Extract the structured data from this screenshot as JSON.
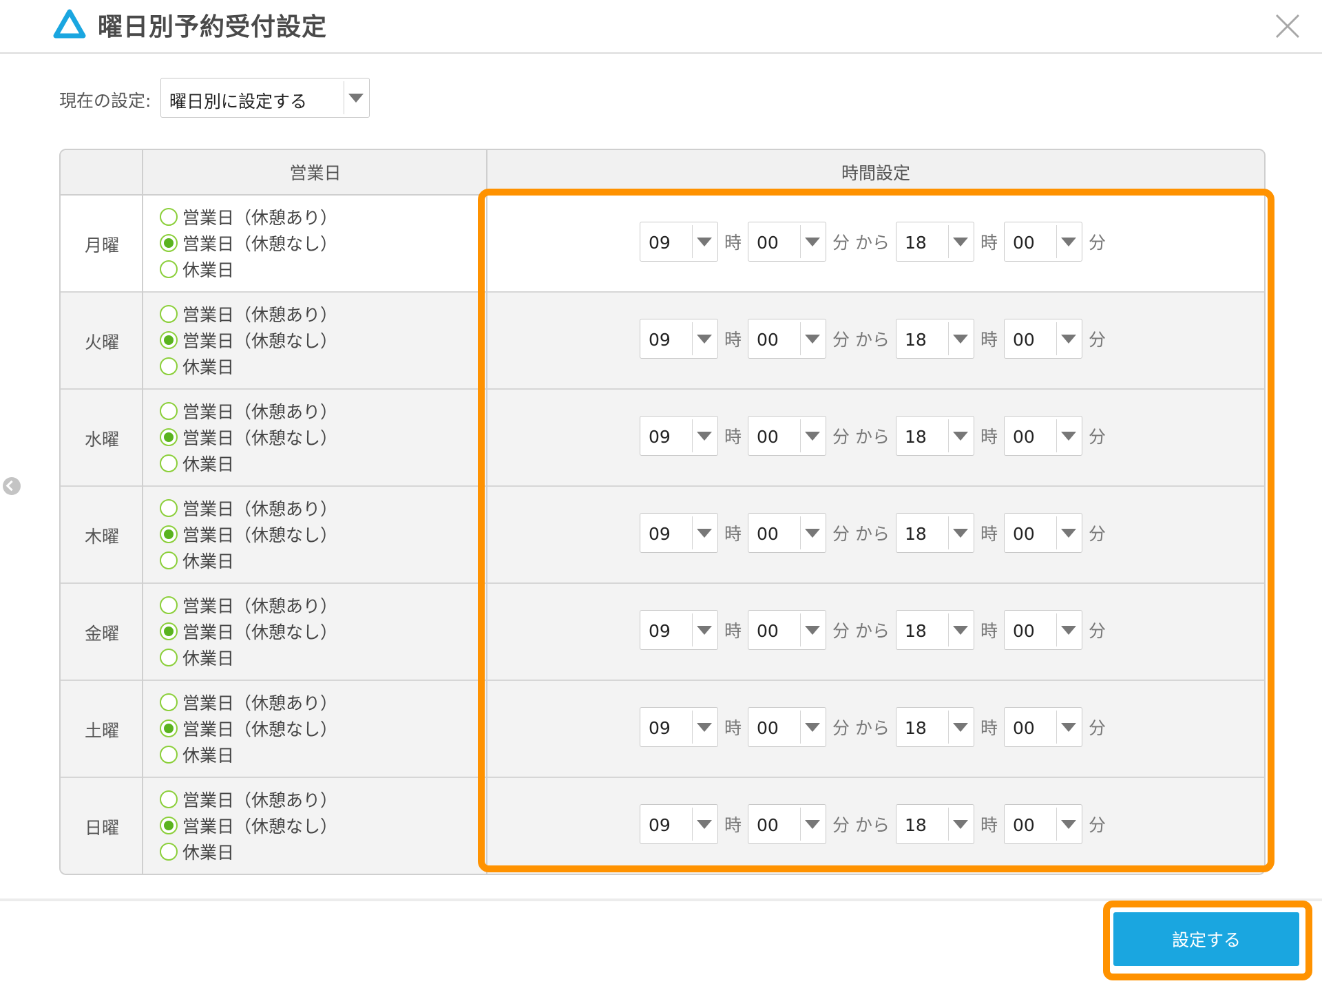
{
  "header": {
    "title": "曜日別予約受付設定",
    "logo_icon": "triangle-logo-icon",
    "close_icon": "close-icon"
  },
  "current_setting": {
    "label": "現在の設定:",
    "value": "曜日別に設定する"
  },
  "table": {
    "headers": [
      "",
      "営業日",
      "時間設定"
    ],
    "option_labels": [
      "営業日（休憩あり）",
      "営業日（休憩なし）",
      "休業日"
    ],
    "units": {
      "hour": "時",
      "minute": "分",
      "from": "分 から"
    },
    "rows": [
      {
        "day": "月曜",
        "selected": 1,
        "start_hour": "09",
        "start_min": "00",
        "end_hour": "18",
        "end_min": "00"
      },
      {
        "day": "火曜",
        "selected": 1,
        "start_hour": "09",
        "start_min": "00",
        "end_hour": "18",
        "end_min": "00"
      },
      {
        "day": "水曜",
        "selected": 1,
        "start_hour": "09",
        "start_min": "00",
        "end_hour": "18",
        "end_min": "00"
      },
      {
        "day": "木曜",
        "selected": 1,
        "start_hour": "09",
        "start_min": "00",
        "end_hour": "18",
        "end_min": "00"
      },
      {
        "day": "金曜",
        "selected": 1,
        "start_hour": "09",
        "start_min": "00",
        "end_hour": "18",
        "end_min": "00"
      },
      {
        "day": "土曜",
        "selected": 1,
        "start_hour": "09",
        "start_min": "00",
        "end_hour": "18",
        "end_min": "00"
      },
      {
        "day": "日曜",
        "selected": 1,
        "start_hour": "09",
        "start_min": "00",
        "end_hour": "18",
        "end_min": "00"
      }
    ]
  },
  "footer": {
    "submit_label": "設定する"
  },
  "colors": {
    "accent": "#1aa6e0",
    "highlight": "#ff9200",
    "radio": "#5ab31e",
    "logo": "#1aa6e0"
  }
}
